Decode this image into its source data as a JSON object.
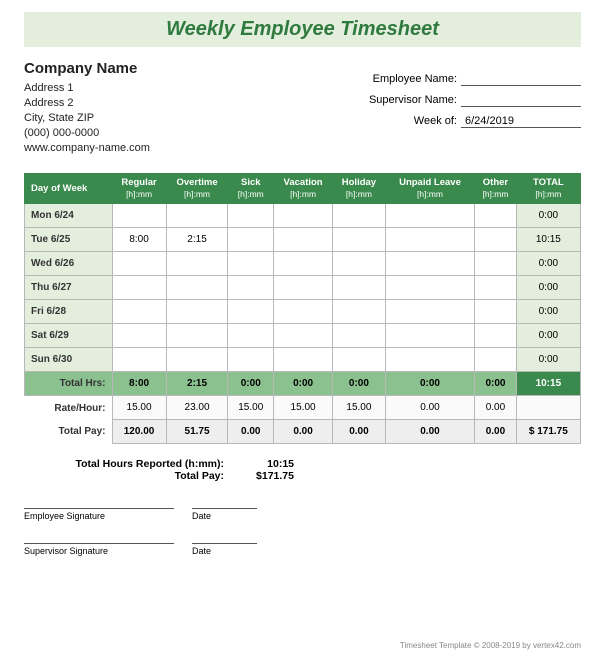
{
  "title": "Weekly Employee Timesheet",
  "company": {
    "name": "Company Name",
    "address1": "Address 1",
    "address2": "Address 2",
    "cityStateZip": "City, State  ZIP",
    "phone": "(000) 000-0000",
    "website": "www.company-name.com"
  },
  "fields": {
    "employeeNameLabel": "Employee Name:",
    "employeeName": "",
    "supervisorNameLabel": "Supervisor Name:",
    "supervisorName": "",
    "weekOfLabel": "Week of:",
    "weekOf": "6/24/2019"
  },
  "headers": {
    "dayOfWeek": "Day of Week",
    "regular": "Regular",
    "overtime": "Overtime",
    "sick": "Sick",
    "vacation": "Vacation",
    "holiday": "Holiday",
    "unpaidLeave": "Unpaid Leave",
    "other": "Other",
    "total": "TOTAL",
    "hmm": "[h]:mm"
  },
  "rows": [
    {
      "day": "Mon 6/24",
      "regular": "",
      "overtime": "",
      "sick": "",
      "vacation": "",
      "holiday": "",
      "unpaid": "",
      "other": "",
      "total": "0:00"
    },
    {
      "day": "Tue 6/25",
      "regular": "8:00",
      "overtime": "2:15",
      "sick": "",
      "vacation": "",
      "holiday": "",
      "unpaid": "",
      "other": "",
      "total": "10:15"
    },
    {
      "day": "Wed 6/26",
      "regular": "",
      "overtime": "",
      "sick": "",
      "vacation": "",
      "holiday": "",
      "unpaid": "",
      "other": "",
      "total": "0:00"
    },
    {
      "day": "Thu 6/27",
      "regular": "",
      "overtime": "",
      "sick": "",
      "vacation": "",
      "holiday": "",
      "unpaid": "",
      "other": "",
      "total": "0:00"
    },
    {
      "day": "Fri 6/28",
      "regular": "",
      "overtime": "",
      "sick": "",
      "vacation": "",
      "holiday": "",
      "unpaid": "",
      "other": "",
      "total": "0:00"
    },
    {
      "day": "Sat 6/29",
      "regular": "",
      "overtime": "",
      "sick": "",
      "vacation": "",
      "holiday": "",
      "unpaid": "",
      "other": "",
      "total": "0:00"
    },
    {
      "day": "Sun 6/30",
      "regular": "",
      "overtime": "",
      "sick": "",
      "vacation": "",
      "holiday": "",
      "unpaid": "",
      "other": "",
      "total": "0:00"
    }
  ],
  "totalHrs": {
    "label": "Total Hrs:",
    "regular": "8:00",
    "overtime": "2:15",
    "sick": "0:00",
    "vacation": "0:00",
    "holiday": "0:00",
    "unpaid": "0:00",
    "other": "0:00",
    "total": "10:15"
  },
  "rate": {
    "label": "Rate/Hour:",
    "regular": "15.00",
    "overtime": "23.00",
    "sick": "15.00",
    "vacation": "15.00",
    "holiday": "15.00",
    "unpaid": "0.00",
    "other": "0.00",
    "total": ""
  },
  "pay": {
    "label": "Total Pay:",
    "regular": "120.00",
    "overtime": "51.75",
    "sick": "0.00",
    "vacation": "0.00",
    "holiday": "0.00",
    "unpaid": "0.00",
    "other": "0.00",
    "total": "$   171.75"
  },
  "summary": {
    "hoursLabel": "Total Hours Reported (h:mm):",
    "hoursValue": "10:15",
    "payLabel": "Total Pay:",
    "payValue": "$171.75"
  },
  "signatures": {
    "employee": "Employee Signature",
    "supervisor": "Supervisor Signature",
    "date": "Date"
  },
  "footer": "Timesheet Template © 2008-2019 by vertex42.com"
}
